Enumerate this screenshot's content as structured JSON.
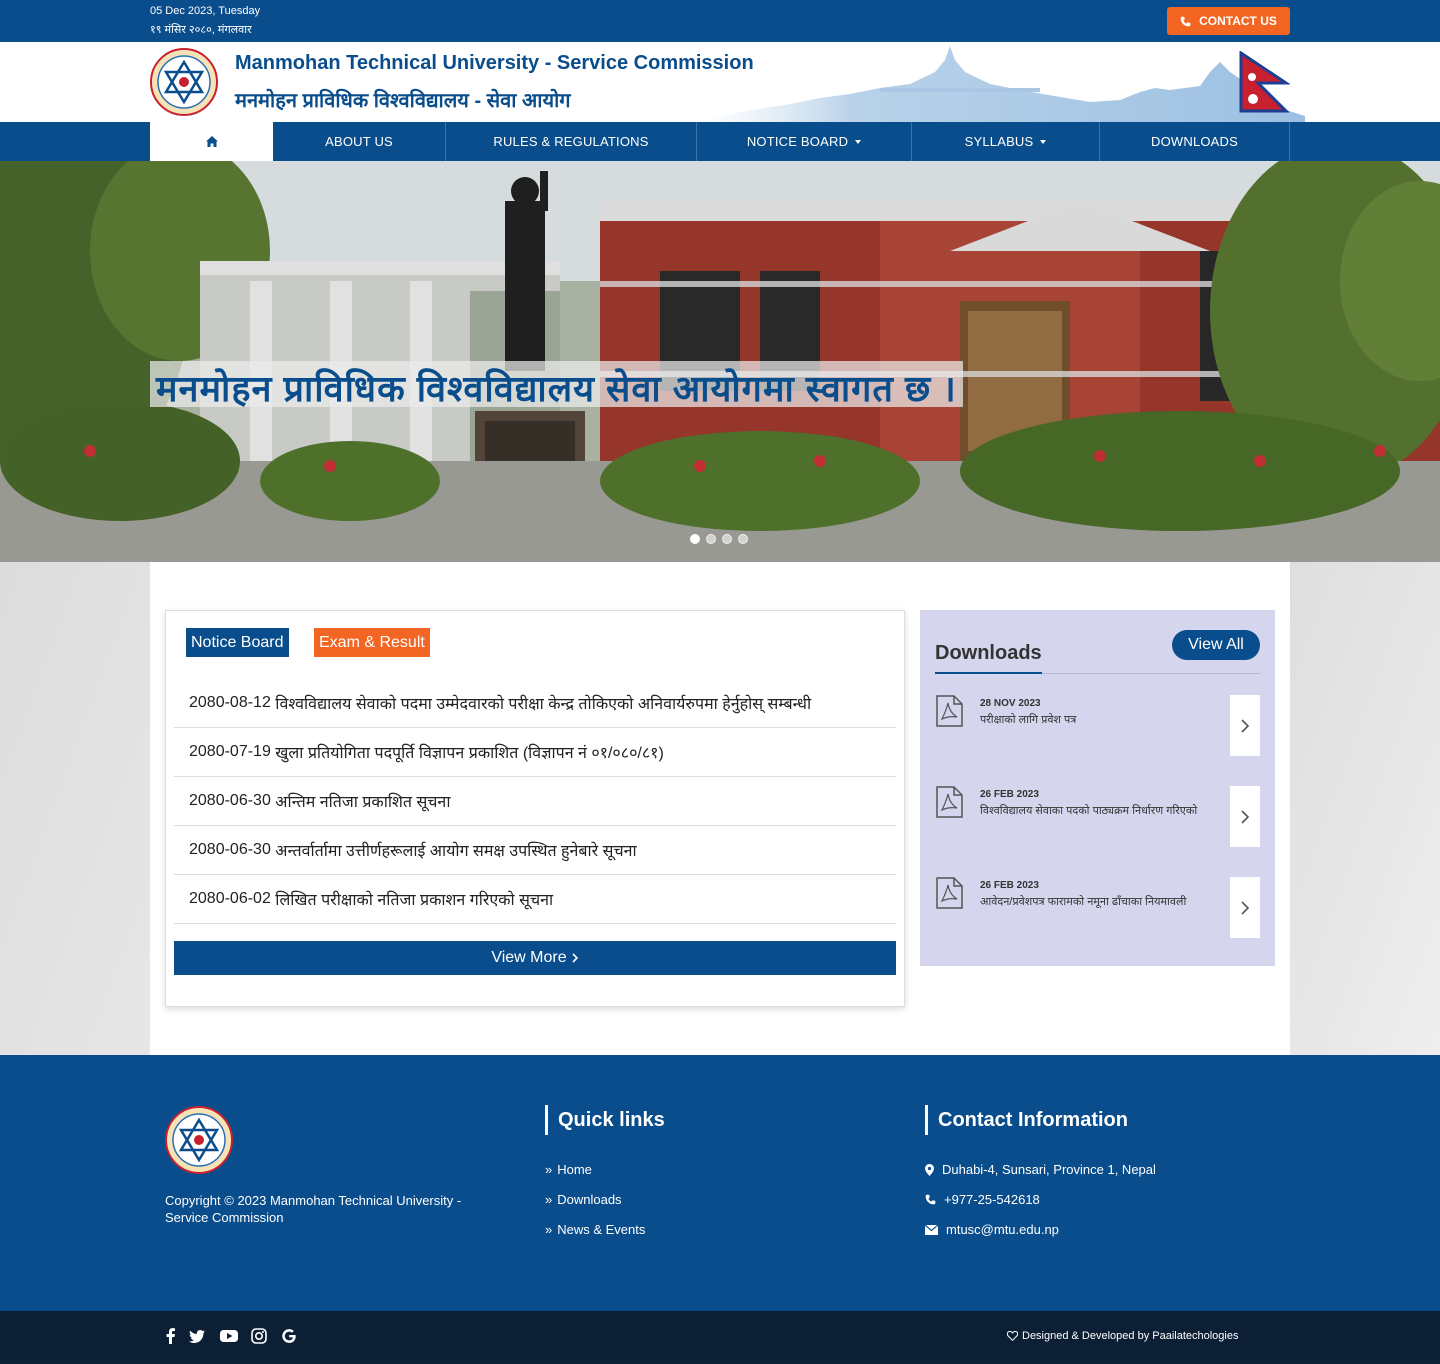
{
  "topbar": {
    "date_en": "05 Dec 2023, Tuesday",
    "date_np": "१९ मंसिर २०८०, मंगलवार",
    "contact_label": "CONTACT US"
  },
  "header": {
    "title_en": "Manmohan Technical University - Service Commission",
    "title_np": "मनमोहन प्राविधिक विश्वविद्यालय - सेवा आयोग"
  },
  "nav": {
    "items": [
      {
        "label": "",
        "icon": "home-icon"
      },
      {
        "label": "ABOUT US"
      },
      {
        "label": "RULES & REGULATIONS"
      },
      {
        "label": "NOTICE BOARD",
        "dropdown": true
      },
      {
        "label": "SYLLABUS",
        "dropdown": true
      },
      {
        "label": "DOWNLOADS"
      }
    ]
  },
  "slider": {
    "caption": "मनमोहन प्राविधिक विश्वविद्यालय सेवा आयोगमा स्वागत छ ।",
    "slide_count": 4,
    "active_index": 0
  },
  "notices": {
    "tabs": [
      "Notice Board",
      "Exam & Result"
    ],
    "active_tab": 0,
    "items": [
      {
        "date": "2080-08-12",
        "text": "विश्वविद्यालय सेवाको पदमा उम्मेदवारको परीक्षा केन्द्र तोकिएको अनिवार्यरुपमा हेर्नुहोस् सम्बन्धी"
      },
      {
        "date": "2080-07-19",
        "text": "खुला प्रतियोगिता पदपूर्ति विज्ञापन प्रकाशित (विज्ञापन नं ०१/०८०/८१)"
      },
      {
        "date": "2080-06-30",
        "text": "अन्तिम नतिजा प्रकाशित सूचना"
      },
      {
        "date": "2080-06-30",
        "text": "अन्तर्वार्तामा उत्तीर्णहरूलाई आयोग समक्ष उपस्थित हुनेबारे सूचना"
      },
      {
        "date": "2080-06-02",
        "text": "लिखित परीक्षाको नतिजा प्रकाशन गरिएको सूचना"
      }
    ],
    "view_more": "View More"
  },
  "downloads": {
    "title": "Downloads",
    "view_all": "View All",
    "items": [
      {
        "date": "28 NOV 2023",
        "name": "परीक्षाको लागि प्रवेश पत्र"
      },
      {
        "date": "26 FEB 2023",
        "name": "विश्वविद्यालय सेवाका पदको पाठ्यक्रम निर्धारण गरिएको"
      },
      {
        "date": "26 FEB 2023",
        "name": "आवेदन/प्रवेशपत्र फारामको नमूना ढाँचाका नियमावली"
      }
    ]
  },
  "footer": {
    "copyright": "Copyright © 2023 Manmohan Technical University - Service Commission",
    "quick_links_title": "Quick links",
    "quick_links": [
      "Home",
      "Downloads",
      "News & Events"
    ],
    "contact_title": "Contact Information",
    "address": "Duhabi-4, Sunsari, Province 1, Nepal",
    "phone": "+977-25-542618",
    "email": "mtusc@mtu.edu.np",
    "social_icons": [
      "facebook-icon",
      "twitter-icon",
      "youtube-icon",
      "instagram-icon",
      "google-icon"
    ],
    "credit": "Designed & Developed by Paailatechologies"
  },
  "colors": {
    "primary": "#0a4d8c",
    "accent": "#f26522",
    "downloads_bg": "#d5d6ee",
    "bottom_bar": "#0d1f34"
  }
}
